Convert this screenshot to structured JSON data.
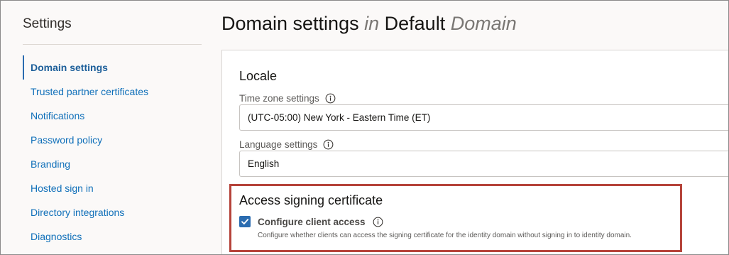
{
  "sidebar": {
    "title": "Settings",
    "items": [
      {
        "label": "Domain settings",
        "active": true
      },
      {
        "label": "Trusted partner certificates",
        "active": false
      },
      {
        "label": "Notifications",
        "active": false
      },
      {
        "label": "Password policy",
        "active": false
      },
      {
        "label": "Branding",
        "active": false
      },
      {
        "label": "Hosted sign in",
        "active": false
      },
      {
        "label": "Directory integrations",
        "active": false
      },
      {
        "label": "Diagnostics",
        "active": false
      }
    ]
  },
  "header": {
    "title_part1": "Domain settings",
    "title_in": "in",
    "title_part2": "Default",
    "title_domain": "Domain"
  },
  "locale": {
    "section_title": "Locale",
    "timezone": {
      "label": "Time zone settings",
      "value": "(UTC-05:00) New York - Eastern Time (ET)",
      "icon": "info-icon"
    },
    "language": {
      "label": "Language settings",
      "value": "English",
      "icon": "info-icon"
    }
  },
  "access_signing": {
    "section_title": "Access signing certificate",
    "checkbox": {
      "label": "Configure client access",
      "checked": true,
      "help": "Configure whether clients can access the signing certificate for the identity domain without signing in to identity domain."
    }
  },
  "colors": {
    "link": "#0f6fb9",
    "accent": "#2b6cb0",
    "highlight": "#b5433a"
  }
}
